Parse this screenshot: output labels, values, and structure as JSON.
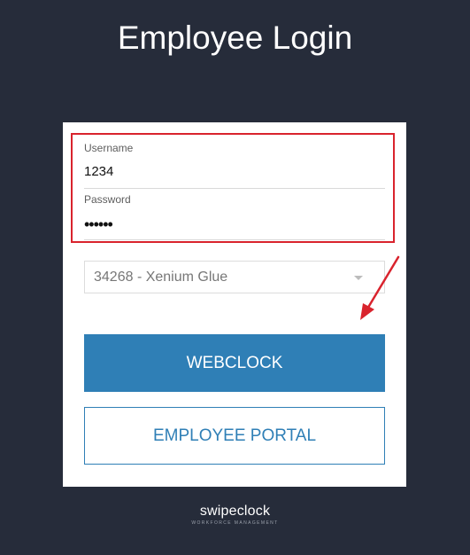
{
  "page": {
    "title": "Employee Login"
  },
  "form": {
    "username": {
      "label": "Username",
      "value": "1234"
    },
    "password": {
      "label": "Password",
      "value": "••••••"
    },
    "account_select": {
      "selected": "34268 - Xenium Glue"
    }
  },
  "buttons": {
    "webclock": "WEBCLOCK",
    "employee_portal": "EMPLOYEE PORTAL"
  },
  "brand": {
    "name": "swipeclock",
    "tagline": "WORKFORCE MANAGEMENT"
  },
  "colors": {
    "background": "#262c3a",
    "primary": "#2f7fb6",
    "highlight": "#d9232d"
  }
}
